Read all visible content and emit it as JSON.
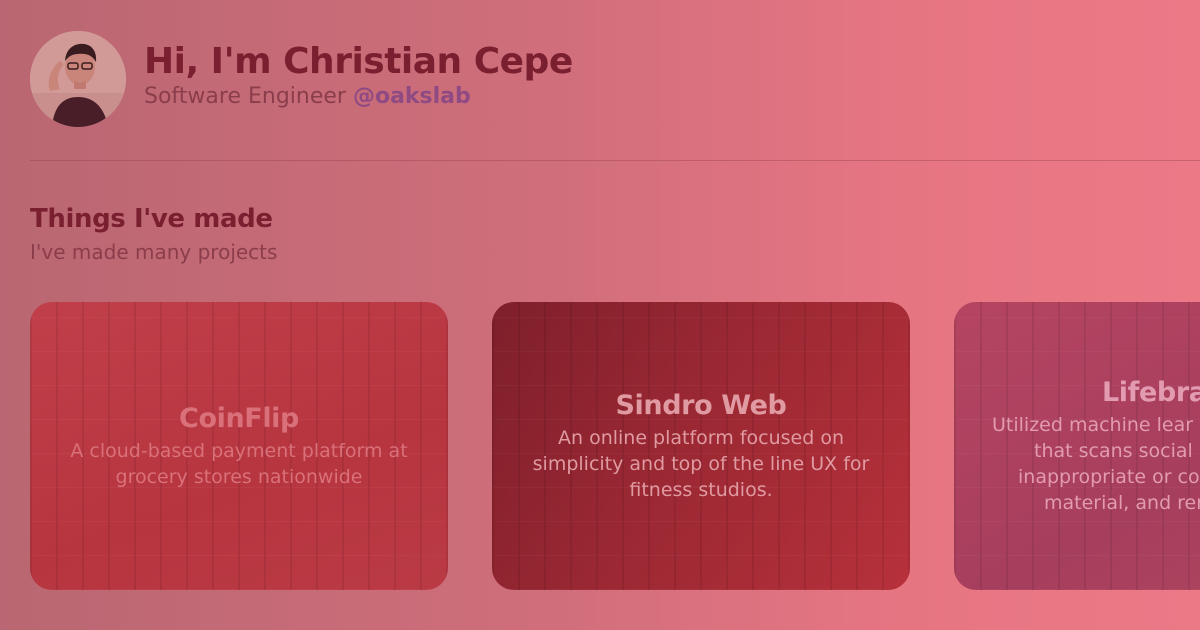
{
  "profile": {
    "name": "Hi, I'm Christian Cepe",
    "role": "Software Engineer",
    "handle": "@oakslab"
  },
  "section": {
    "title": "Things I've made",
    "subtitle": "I've made many projects"
  },
  "projects": [
    {
      "title": "CoinFlip",
      "description": "A cloud-based payment platform at grocery stores nationwide"
    },
    {
      "title": "Sindro Web",
      "description": "An online platform focused on simplicity and top of the line UX for fitness studios."
    },
    {
      "title": "Lifebran",
      "description_lines": [
        "Utilized machine lear",
        "that scans social",
        "inappropriate or co",
        "material, and rer"
      ]
    }
  ],
  "colors": {
    "name": "#7a1f2f",
    "handle": "#8f4a83",
    "background_left": "#b96772",
    "background_right": "#ec7986"
  },
  "icons": [
    "avatar-photo"
  ]
}
